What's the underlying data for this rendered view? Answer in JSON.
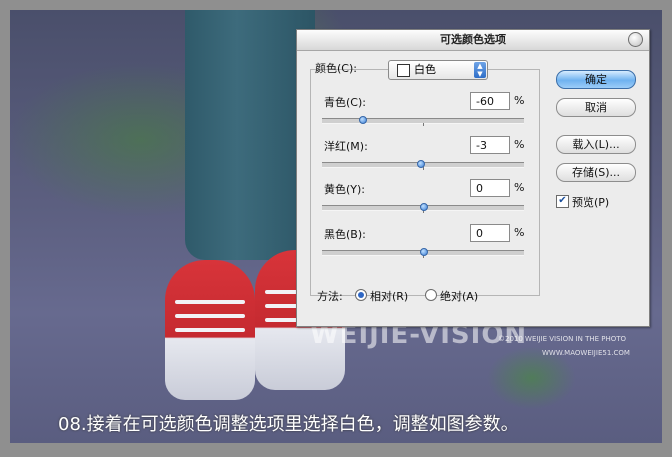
{
  "dialog": {
    "title": "可选颜色选项",
    "color_label": "颜色(C):",
    "color_value": "白色",
    "sliders": [
      {
        "label": "青色(C):",
        "value": "-60",
        "unit": "%",
        "level": -60
      },
      {
        "label": "洋红(M):",
        "value": "-3",
        "unit": "%",
        "level": -3
      },
      {
        "label": "黄色(Y):",
        "value": "0",
        "unit": "%",
        "level": 0
      },
      {
        "label": "黑色(B):",
        "value": "0",
        "unit": "%",
        "level": 0
      }
    ],
    "buttons": {
      "ok": "确定",
      "cancel": "取消",
      "load": "载入(L)...",
      "save": "存储(S)..."
    },
    "preview": {
      "label": "预览(P)",
      "checked": true
    },
    "method": {
      "label": "方法:",
      "relative": "相对(R)",
      "absolute": "绝对(A)",
      "selected": "relative"
    }
  },
  "watermark": {
    "logo": "WEIJIE-VISION",
    "line1": "©2010 WEIJIE VISION IN THE PHOTO",
    "line2": "WWW.MAOWEIJIE51.COM"
  },
  "caption": "08.接着在可选颜色调整选项里选择白色，调整如图参数。",
  "colors": {
    "accent": "#3d7fd6",
    "caption": "#ffffff"
  },
  "icons": [
    "close-icon",
    "dropdown-arrow-icon",
    "checkbox-check-icon"
  ]
}
